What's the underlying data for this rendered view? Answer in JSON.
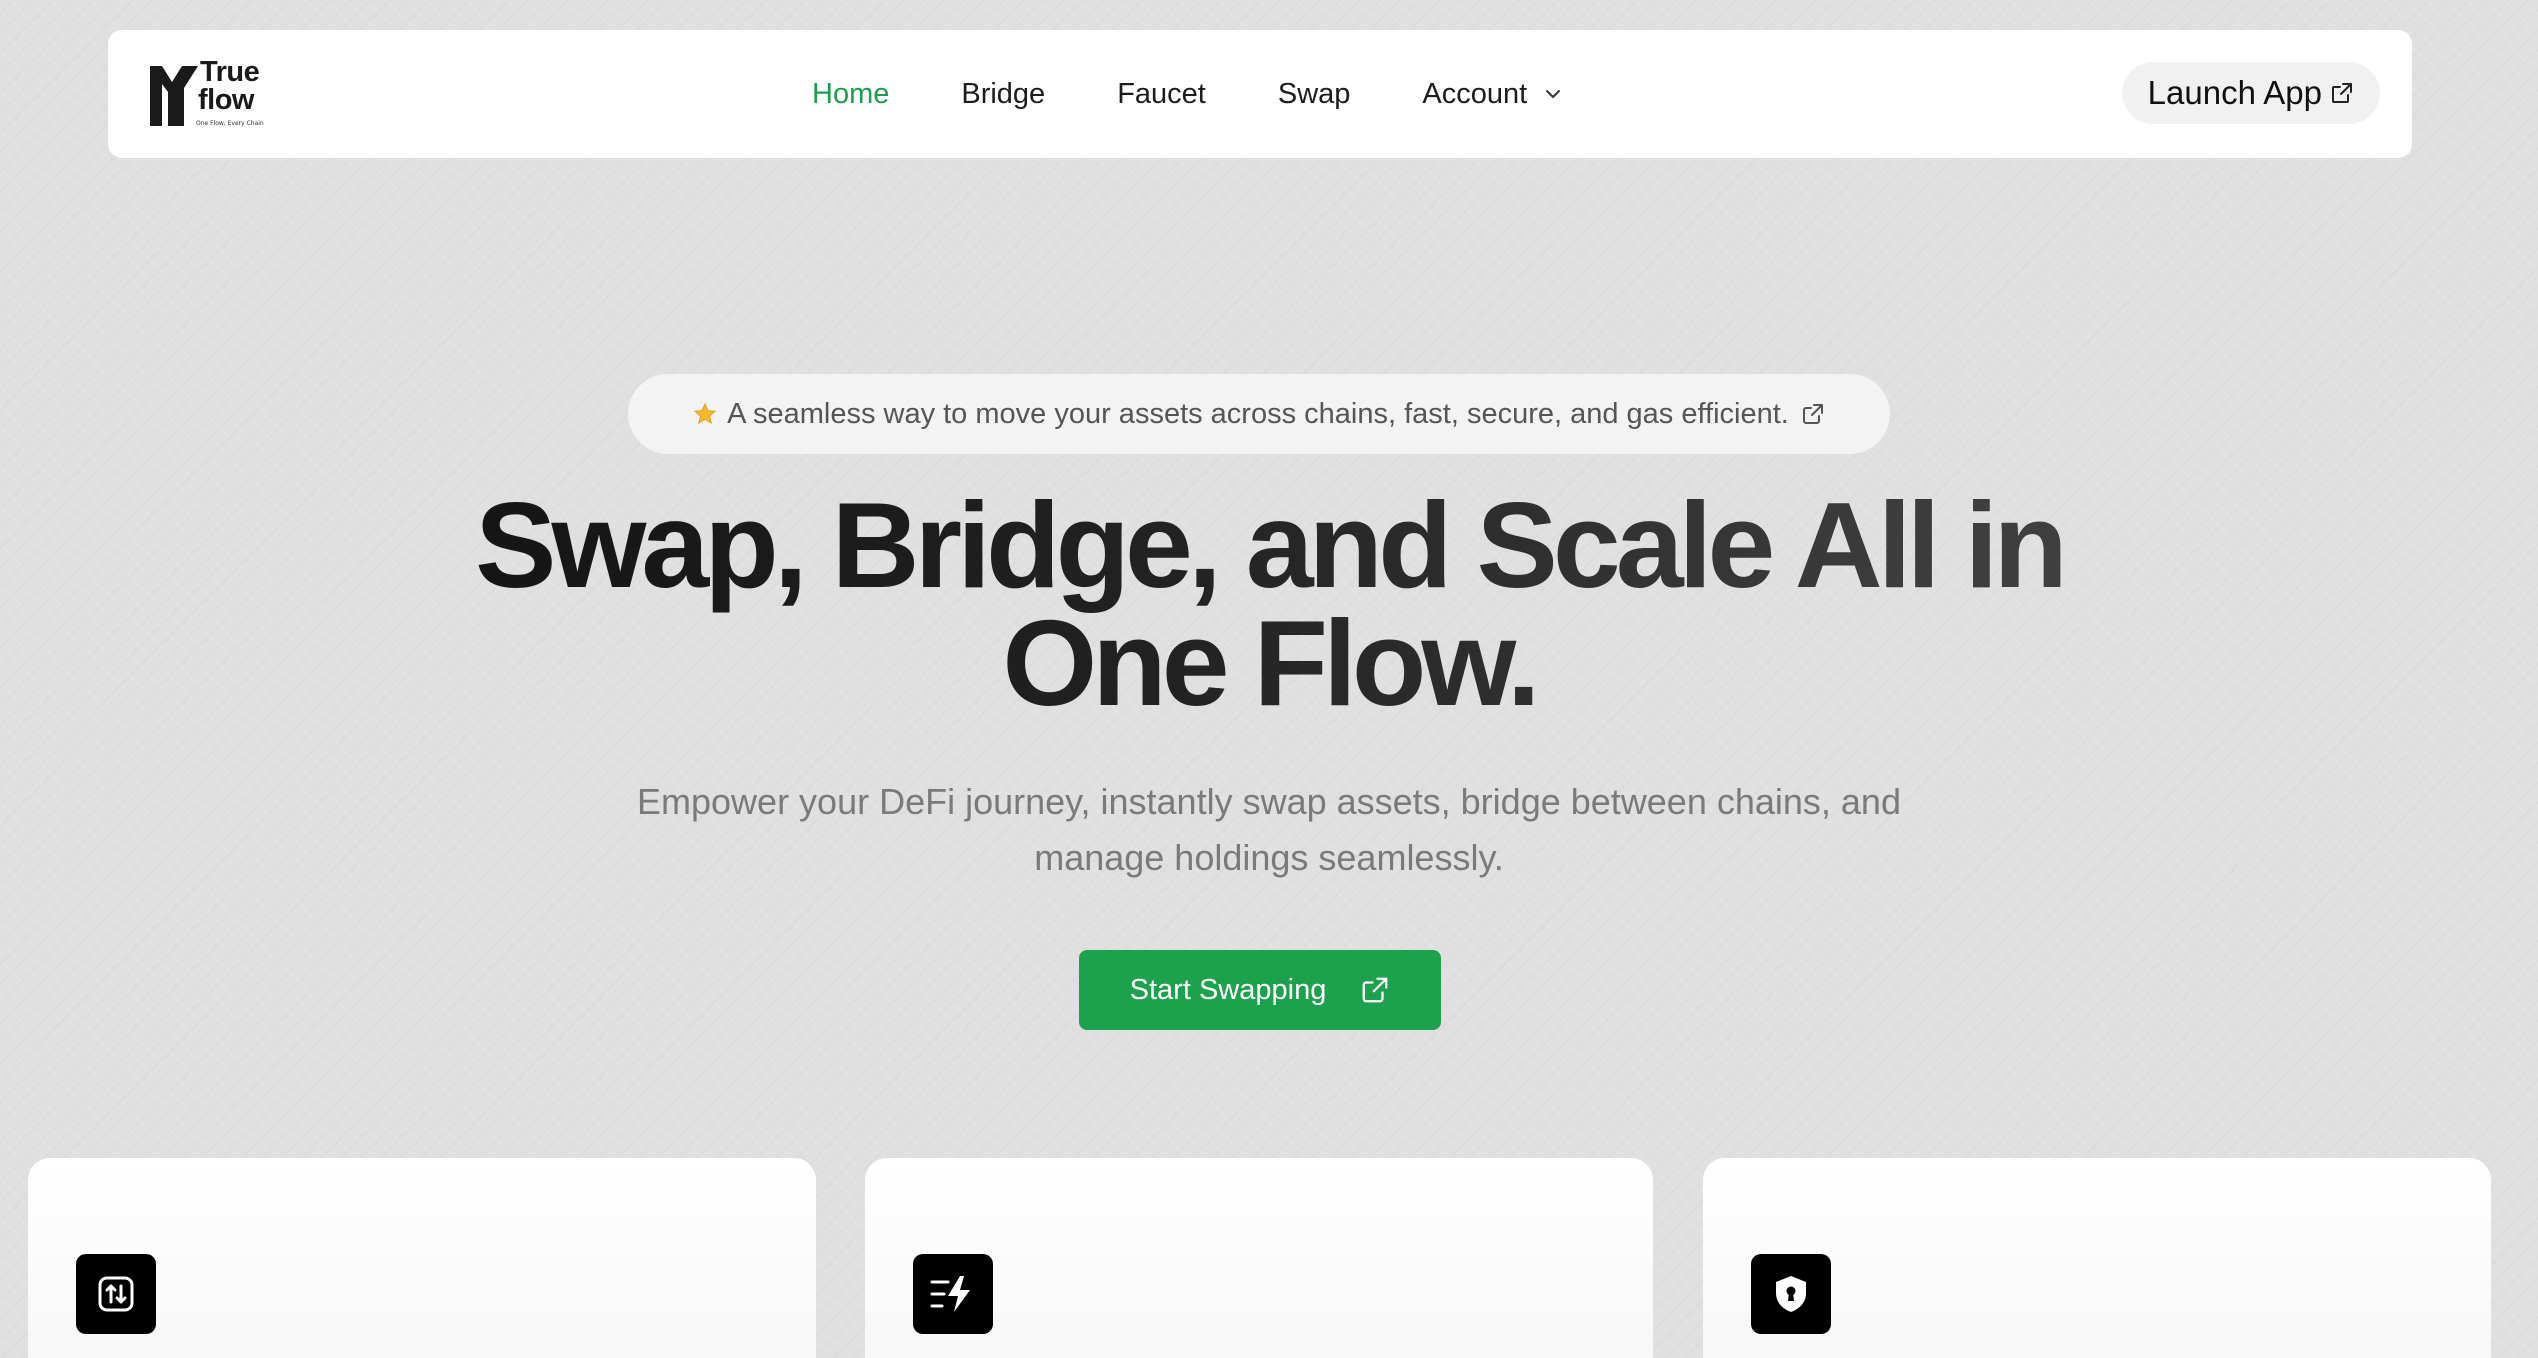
{
  "brand": {
    "name_line1": "True",
    "name_line2": "flow",
    "tagline": "One Flow, Every Chain"
  },
  "nav": {
    "items": [
      {
        "label": "Home",
        "active": true
      },
      {
        "label": "Bridge",
        "active": false
      },
      {
        "label": "Faucet",
        "active": false
      },
      {
        "label": "Swap",
        "active": false
      },
      {
        "label": "Account",
        "active": false,
        "has_dropdown": true
      }
    ],
    "launch_label": "Launch App"
  },
  "announcement": {
    "icon": "star-icon",
    "text": "A seamless way to move your assets across chains, fast, secure, and gas efficient."
  },
  "hero": {
    "title_line1": "Swap, Bridge, and Scale All in",
    "title_line2": "One Flow.",
    "subtitle_line1": "Empower your DeFi journey, instantly swap assets, bridge between chains, and",
    "subtitle_line2": "manage holdings seamlessly.",
    "cta_label": "Start Swapping"
  },
  "feature_cards": [
    {
      "icon": "swap-arrows-icon"
    },
    {
      "icon": "fast-bolt-icon"
    },
    {
      "icon": "shield-lock-icon"
    }
  ],
  "colors": {
    "accent": "#1ca14c",
    "active_link": "#1b9e4b",
    "background": "#e0e0e0"
  }
}
